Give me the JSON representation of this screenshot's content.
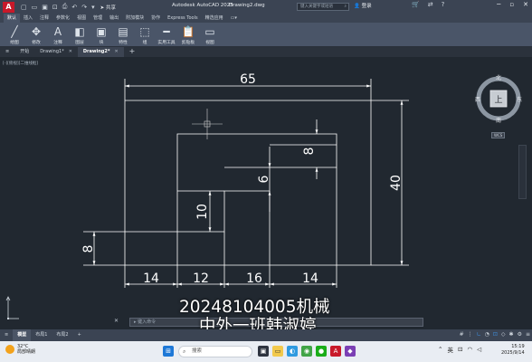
{
  "titlebar": {
    "logo": "A",
    "share": "共享",
    "app_title": "Autodesk AutoCAD 2025",
    "doc_title": "Drawing2.dwg",
    "search_placeholder": "键入关键字或短语",
    "login": "登录"
  },
  "ribbon_tabs": [
    "默认",
    "插入",
    "注释",
    "参数化",
    "视图",
    "管理",
    "输出",
    "附加模块",
    "协作",
    "Express Tools",
    "精选应用"
  ],
  "ribbon_buttons": [
    {
      "label": "绘图",
      "icon": "line-draw-icon",
      "glyph": "╱"
    },
    {
      "label": "修改",
      "icon": "move-icon",
      "glyph": "✥"
    },
    {
      "label": "注释",
      "icon": "text-icon",
      "glyph": "A"
    },
    {
      "label": "图层",
      "icon": "layers-icon",
      "glyph": "◧"
    },
    {
      "label": "块",
      "icon": "block-icon",
      "glyph": "▣"
    },
    {
      "label": "特性",
      "icon": "properties-icon",
      "glyph": "▤"
    },
    {
      "label": "组",
      "icon": "group-icon",
      "glyph": "⬚"
    },
    {
      "label": "实用工具",
      "icon": "measure-icon",
      "glyph": "━"
    },
    {
      "label": "剪贴板",
      "icon": "clipboard-icon",
      "glyph": "📋"
    },
    {
      "label": "视图",
      "icon": "view-icon",
      "glyph": "▭"
    }
  ],
  "file_tabs": [
    {
      "label": "开始",
      "active": false
    },
    {
      "label": "Drawing1*",
      "active": false
    },
    {
      "label": "Drawing2*",
      "active": true
    }
  ],
  "viewport_label": "[-][俯视][二维线框]",
  "drawing": {
    "dims": {
      "total_width": "65",
      "total_height": "40",
      "d14a": "14",
      "d12": "12",
      "d16": "16",
      "d14b": "14",
      "left_8": "8",
      "step_10": "10",
      "step_6": "6",
      "top_8": "8"
    },
    "line_color": "#ffffff",
    "bg_color": "#212830"
  },
  "viewcube": {
    "north": "北",
    "south": "南",
    "east": "东",
    "west": "西",
    "top": "上",
    "wcs": "WCS"
  },
  "command_line": {
    "placeholder": "键入命令"
  },
  "overlay": {
    "line1": "20248104005机械",
    "line2": "中外一班韩淑婷"
  },
  "layout_tabs": [
    {
      "label": "模型",
      "active": true
    },
    {
      "label": "布局1",
      "active": false
    },
    {
      "label": "布局2",
      "active": false
    }
  ],
  "taskbar": {
    "temperature": "32°C",
    "weather": "局部晴朗",
    "search": "搜索",
    "ime": "英",
    "time": "15:19",
    "date": "2025/9/14"
  }
}
